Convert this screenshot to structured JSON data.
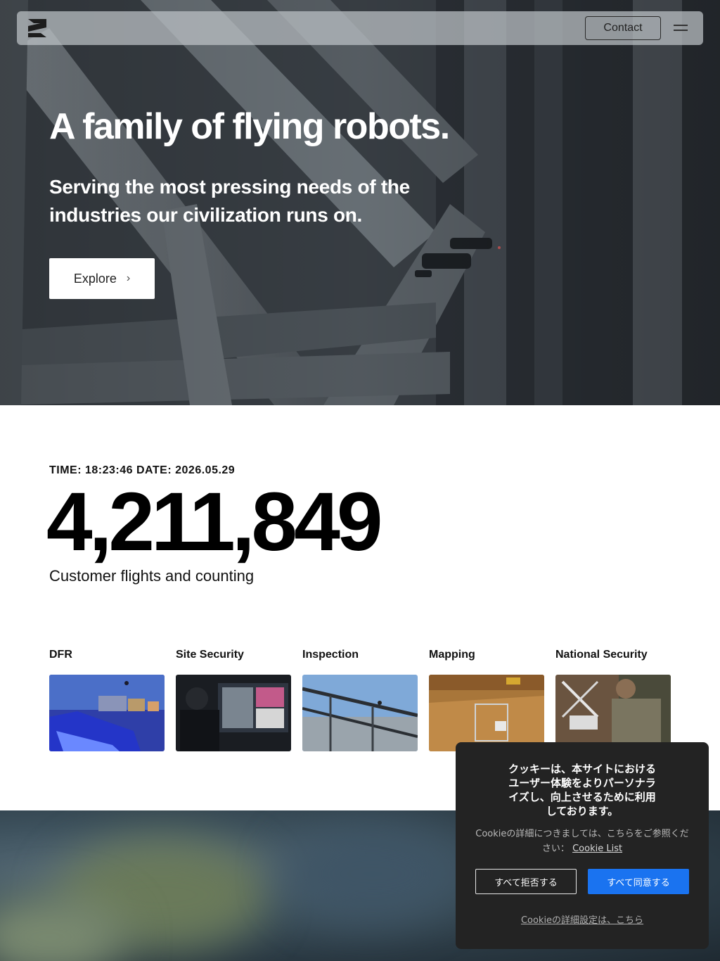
{
  "nav": {
    "logo_icon": "brand-logo-icon",
    "contact_label": "Contact",
    "menu_icon": "hamburger-menu-icon"
  },
  "hero": {
    "title": "A family of flying robots.",
    "subtitle": "Serving the most pressing needs of the industries our civilization runs on.",
    "explore_label": "Explore",
    "explore_icon": "chevron-right-icon"
  },
  "stats": {
    "timestamp": "TIME: 18:23:46 DATE: 2026.05.29",
    "flight_count": "4,211,849",
    "flight_label": "Customer flights and counting"
  },
  "categories": [
    {
      "label": "DFR"
    },
    {
      "label": "Site Security"
    },
    {
      "label": "Inspection"
    },
    {
      "label": "Mapping"
    },
    {
      "label": "National Security"
    }
  ],
  "cookie": {
    "title": "クッキーは、本サイトにおけるユーザー体験をよりパーソナライズし、向上させるために利用しております。",
    "description": "Cookieの詳細につきましては、こちらをご参照ください：",
    "link_label": "Cookie List",
    "reject_label": "すべて拒否する",
    "accept_label": "すべて同意する",
    "settings_label": "Cookieの詳細設定は、こちら",
    "accept_color": "#1a73f0",
    "panel_color": "#232323"
  }
}
